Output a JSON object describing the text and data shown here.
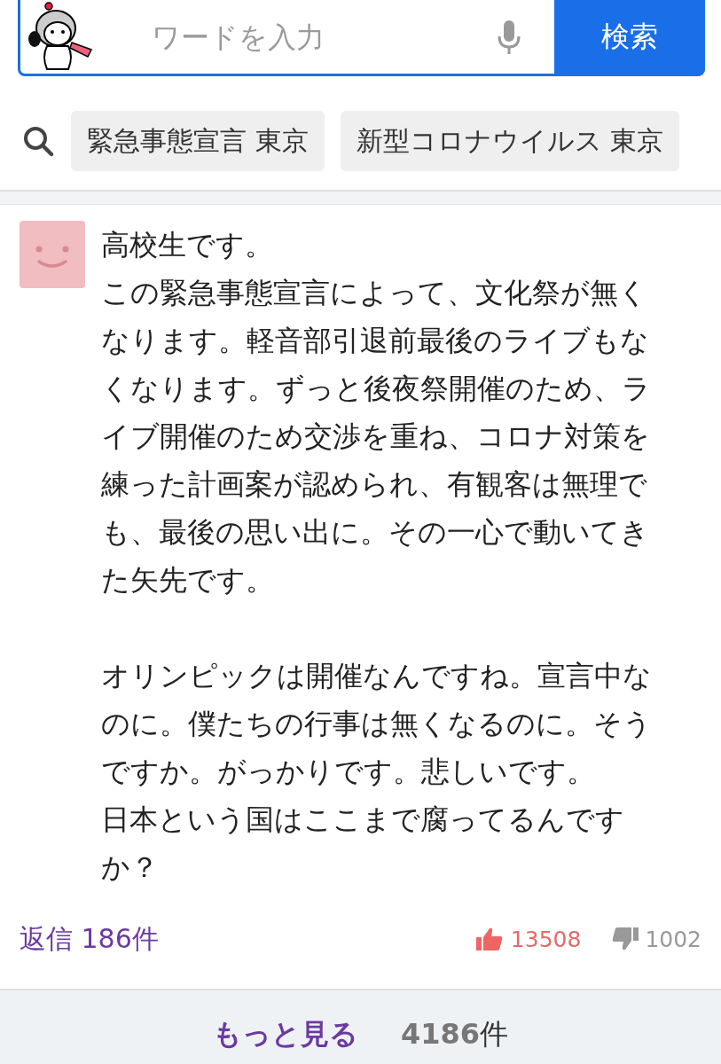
{
  "search": {
    "placeholder": "ワードを入力",
    "button": "検索"
  },
  "suggestions": [
    "緊急事態宣言 東京",
    "新型コロナウイルス 東京"
  ],
  "comment": {
    "paragraphs": [
      {
        "lines": [
          "高校生です。",
          "この緊急事態宣言によって、文化祭が無くなります。軽音部引退前最後のライブもなくなります。ずっと後夜祭開催のため、ライブ開催のため交渉を重ね、コロナ対策を練った計画案が認められ、有観客は無理でも、最後の思い出に。その一心で動いてきた矢先です。"
        ]
      },
      {
        "lines": [
          "オリンピックは開催なんですね。宣言中なのに。僕たちの行事は無くなるのに。そうですか。がっかりです。悲しいです。",
          "日本という国はここまで腐ってるんですか？"
        ]
      }
    ],
    "replies": "返信 186件",
    "likes": "13508",
    "dislikes": "1002"
  },
  "more": {
    "label": "もっと見る",
    "count": "**4186**件"
  }
}
